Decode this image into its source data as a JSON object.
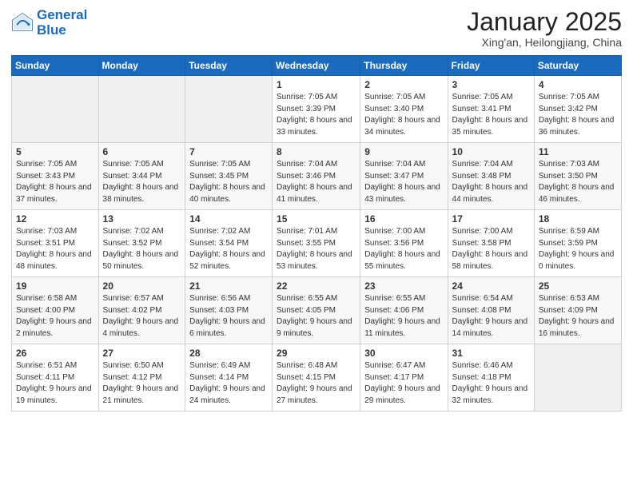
{
  "logo": {
    "line1": "General",
    "line2": "Blue"
  },
  "title": "January 2025",
  "subtitle": "Xing'an, Heilongjiang, China",
  "weekdays": [
    "Sunday",
    "Monday",
    "Tuesday",
    "Wednesday",
    "Thursday",
    "Friday",
    "Saturday"
  ],
  "weeks": [
    [
      {
        "day": "",
        "sunrise": "",
        "sunset": "",
        "daylight": ""
      },
      {
        "day": "",
        "sunrise": "",
        "sunset": "",
        "daylight": ""
      },
      {
        "day": "",
        "sunrise": "",
        "sunset": "",
        "daylight": ""
      },
      {
        "day": "1",
        "sunrise": "Sunrise: 7:05 AM",
        "sunset": "Sunset: 3:39 PM",
        "daylight": "Daylight: 8 hours and 33 minutes."
      },
      {
        "day": "2",
        "sunrise": "Sunrise: 7:05 AM",
        "sunset": "Sunset: 3:40 PM",
        "daylight": "Daylight: 8 hours and 34 minutes."
      },
      {
        "day": "3",
        "sunrise": "Sunrise: 7:05 AM",
        "sunset": "Sunset: 3:41 PM",
        "daylight": "Daylight: 8 hours and 35 minutes."
      },
      {
        "day": "4",
        "sunrise": "Sunrise: 7:05 AM",
        "sunset": "Sunset: 3:42 PM",
        "daylight": "Daylight: 8 hours and 36 minutes."
      }
    ],
    [
      {
        "day": "5",
        "sunrise": "Sunrise: 7:05 AM",
        "sunset": "Sunset: 3:43 PM",
        "daylight": "Daylight: 8 hours and 37 minutes."
      },
      {
        "day": "6",
        "sunrise": "Sunrise: 7:05 AM",
        "sunset": "Sunset: 3:44 PM",
        "daylight": "Daylight: 8 hours and 38 minutes."
      },
      {
        "day": "7",
        "sunrise": "Sunrise: 7:05 AM",
        "sunset": "Sunset: 3:45 PM",
        "daylight": "Daylight: 8 hours and 40 minutes."
      },
      {
        "day": "8",
        "sunrise": "Sunrise: 7:04 AM",
        "sunset": "Sunset: 3:46 PM",
        "daylight": "Daylight: 8 hours and 41 minutes."
      },
      {
        "day": "9",
        "sunrise": "Sunrise: 7:04 AM",
        "sunset": "Sunset: 3:47 PM",
        "daylight": "Daylight: 8 hours and 43 minutes."
      },
      {
        "day": "10",
        "sunrise": "Sunrise: 7:04 AM",
        "sunset": "Sunset: 3:48 PM",
        "daylight": "Daylight: 8 hours and 44 minutes."
      },
      {
        "day": "11",
        "sunrise": "Sunrise: 7:03 AM",
        "sunset": "Sunset: 3:50 PM",
        "daylight": "Daylight: 8 hours and 46 minutes."
      }
    ],
    [
      {
        "day": "12",
        "sunrise": "Sunrise: 7:03 AM",
        "sunset": "Sunset: 3:51 PM",
        "daylight": "Daylight: 8 hours and 48 minutes."
      },
      {
        "day": "13",
        "sunrise": "Sunrise: 7:02 AM",
        "sunset": "Sunset: 3:52 PM",
        "daylight": "Daylight: 8 hours and 50 minutes."
      },
      {
        "day": "14",
        "sunrise": "Sunrise: 7:02 AM",
        "sunset": "Sunset: 3:54 PM",
        "daylight": "Daylight: 8 hours and 52 minutes."
      },
      {
        "day": "15",
        "sunrise": "Sunrise: 7:01 AM",
        "sunset": "Sunset: 3:55 PM",
        "daylight": "Daylight: 8 hours and 53 minutes."
      },
      {
        "day": "16",
        "sunrise": "Sunrise: 7:00 AM",
        "sunset": "Sunset: 3:56 PM",
        "daylight": "Daylight: 8 hours and 55 minutes."
      },
      {
        "day": "17",
        "sunrise": "Sunrise: 7:00 AM",
        "sunset": "Sunset: 3:58 PM",
        "daylight": "Daylight: 8 hours and 58 minutes."
      },
      {
        "day": "18",
        "sunrise": "Sunrise: 6:59 AM",
        "sunset": "Sunset: 3:59 PM",
        "daylight": "Daylight: 9 hours and 0 minutes."
      }
    ],
    [
      {
        "day": "19",
        "sunrise": "Sunrise: 6:58 AM",
        "sunset": "Sunset: 4:00 PM",
        "daylight": "Daylight: 9 hours and 2 minutes."
      },
      {
        "day": "20",
        "sunrise": "Sunrise: 6:57 AM",
        "sunset": "Sunset: 4:02 PM",
        "daylight": "Daylight: 9 hours and 4 minutes."
      },
      {
        "day": "21",
        "sunrise": "Sunrise: 6:56 AM",
        "sunset": "Sunset: 4:03 PM",
        "daylight": "Daylight: 9 hours and 6 minutes."
      },
      {
        "day": "22",
        "sunrise": "Sunrise: 6:55 AM",
        "sunset": "Sunset: 4:05 PM",
        "daylight": "Daylight: 9 hours and 9 minutes."
      },
      {
        "day": "23",
        "sunrise": "Sunrise: 6:55 AM",
        "sunset": "Sunset: 4:06 PM",
        "daylight": "Daylight: 9 hours and 11 minutes."
      },
      {
        "day": "24",
        "sunrise": "Sunrise: 6:54 AM",
        "sunset": "Sunset: 4:08 PM",
        "daylight": "Daylight: 9 hours and 14 minutes."
      },
      {
        "day": "25",
        "sunrise": "Sunrise: 6:53 AM",
        "sunset": "Sunset: 4:09 PM",
        "daylight": "Daylight: 9 hours and 16 minutes."
      }
    ],
    [
      {
        "day": "26",
        "sunrise": "Sunrise: 6:51 AM",
        "sunset": "Sunset: 4:11 PM",
        "daylight": "Daylight: 9 hours and 19 minutes."
      },
      {
        "day": "27",
        "sunrise": "Sunrise: 6:50 AM",
        "sunset": "Sunset: 4:12 PM",
        "daylight": "Daylight: 9 hours and 21 minutes."
      },
      {
        "day": "28",
        "sunrise": "Sunrise: 6:49 AM",
        "sunset": "Sunset: 4:14 PM",
        "daylight": "Daylight: 9 hours and 24 minutes."
      },
      {
        "day": "29",
        "sunrise": "Sunrise: 6:48 AM",
        "sunset": "Sunset: 4:15 PM",
        "daylight": "Daylight: 9 hours and 27 minutes."
      },
      {
        "day": "30",
        "sunrise": "Sunrise: 6:47 AM",
        "sunset": "Sunset: 4:17 PM",
        "daylight": "Daylight: 9 hours and 29 minutes."
      },
      {
        "day": "31",
        "sunrise": "Sunrise: 6:46 AM",
        "sunset": "Sunset: 4:18 PM",
        "daylight": "Daylight: 9 hours and 32 minutes."
      },
      {
        "day": "",
        "sunrise": "",
        "sunset": "",
        "daylight": ""
      }
    ]
  ]
}
